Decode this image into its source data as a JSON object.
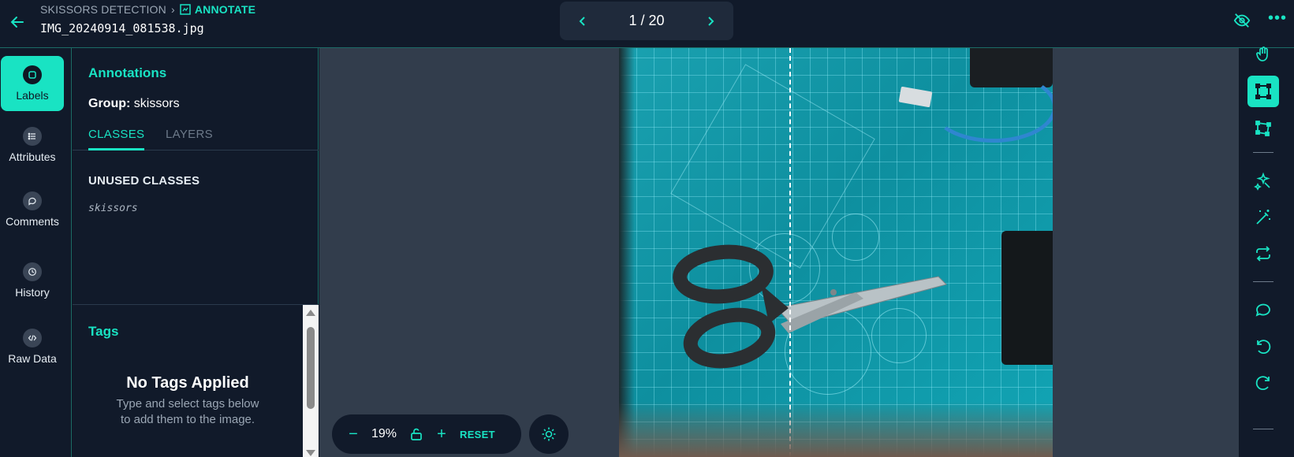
{
  "header": {
    "project": "SKISSORS DETECTION",
    "mode": "ANNOTATE",
    "filename": "IMG_20240914_081538.jpg",
    "pager": "1 / 20"
  },
  "nav": {
    "items": [
      {
        "label": "Labels",
        "icon": "label-icon"
      },
      {
        "label": "Attributes",
        "icon": "list-icon"
      },
      {
        "label": "Comments",
        "icon": "comment-icon"
      },
      {
        "label": "History",
        "icon": "history-icon"
      },
      {
        "label": "Raw Data",
        "icon": "code-icon"
      }
    ]
  },
  "panel": {
    "title": "Annotations",
    "group_label": "Group:",
    "group_value": "skissors",
    "tabs": [
      "CLASSES",
      "LAYERS"
    ],
    "unused_heading": "UNUSED CLASSES",
    "classes": [
      "skissors"
    ],
    "tags_title": "Tags",
    "no_tags": "No Tags Applied",
    "no_tags_line1": "Type and select tags below",
    "no_tags_line2": "to add them to the image."
  },
  "zoom": {
    "value": "19%",
    "reset": "RESET"
  },
  "tools": [
    "hand-icon",
    "bbox-icon",
    "polygon-icon",
    "smart-select-icon",
    "magic-wand-icon",
    "convert-icon",
    "comment-icon",
    "undo-icon",
    "redo-icon"
  ],
  "colors": {
    "accent": "#19e3c3",
    "background": "#111a2a",
    "canvas": "#323d4c"
  }
}
